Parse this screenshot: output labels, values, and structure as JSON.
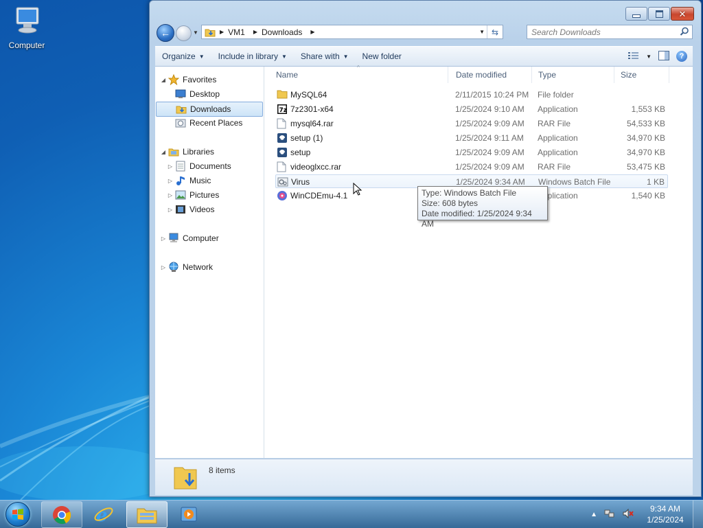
{
  "desktop": {
    "icons": [
      {
        "label": "Computer",
        "icon": "computer-icon"
      }
    ]
  },
  "window": {
    "controls": {
      "minimize": "minimize",
      "maximize": "maximize",
      "close": "close"
    },
    "address": {
      "crumbs": [
        "VM1",
        "Downloads"
      ]
    },
    "search": {
      "placeholder": "Search Downloads"
    },
    "toolbar": {
      "organize": "Organize",
      "include_in_library": "Include in library",
      "share_with": "Share with",
      "new_folder": "New folder"
    },
    "nav": {
      "favorites": "Favorites",
      "desktop": "Desktop",
      "downloads": "Downloads",
      "recent_places": "Recent Places",
      "libraries": "Libraries",
      "documents": "Documents",
      "music": "Music",
      "pictures": "Pictures",
      "videos": "Videos",
      "computer": "Computer",
      "network": "Network"
    },
    "columns": {
      "name": "Name",
      "date_modified": "Date modified",
      "type": "Type",
      "size": "Size"
    },
    "files": [
      {
        "name": "MySQL64",
        "date": "2/11/2015 10:24 PM",
        "type": "File folder",
        "size": "",
        "icon": "folder-icon"
      },
      {
        "name": "7z2301-x64",
        "date": "1/25/2024 9:10 AM",
        "type": "Application",
        "size": "1,553 KB",
        "icon": "7zip-icon"
      },
      {
        "name": "mysql64.rar",
        "date": "1/25/2024 9:09 AM",
        "type": "RAR File",
        "size": "54,533 KB",
        "icon": "document-icon"
      },
      {
        "name": "setup (1)",
        "date": "1/25/2024 9:11 AM",
        "type": "Application",
        "size": "34,970 KB",
        "icon": "setup-icon"
      },
      {
        "name": "setup",
        "date": "1/25/2024 9:09 AM",
        "type": "Application",
        "size": "34,970 KB",
        "icon": "setup-icon"
      },
      {
        "name": "videoglxcc.rar",
        "date": "1/25/2024 9:09 AM",
        "type": "RAR File",
        "size": "53,475 KB",
        "icon": "document-icon"
      },
      {
        "name": "Virus",
        "date": "1/25/2024 9:34 AM",
        "type": "Windows Batch File",
        "size": "1 KB",
        "icon": "batch-file-icon"
      },
      {
        "name": "WinCDEmu-4.1",
        "date": "",
        "type": "Application",
        "size": "1,540 KB",
        "icon": "wincdemu-icon"
      }
    ],
    "tooltip": {
      "type_line": "Type: Windows Batch File",
      "size_line": "Size: 608 bytes",
      "date_line": "Date modified: 1/25/2024 9:34 AM"
    },
    "status": {
      "item_count": "8 items"
    }
  },
  "taskbar": {
    "apps": [
      "chrome-icon",
      "internet-explorer-icon",
      "windows-explorer-icon",
      "media-player-icon"
    ],
    "clock": {
      "time": "9:34 AM",
      "date": "1/25/2024"
    }
  }
}
